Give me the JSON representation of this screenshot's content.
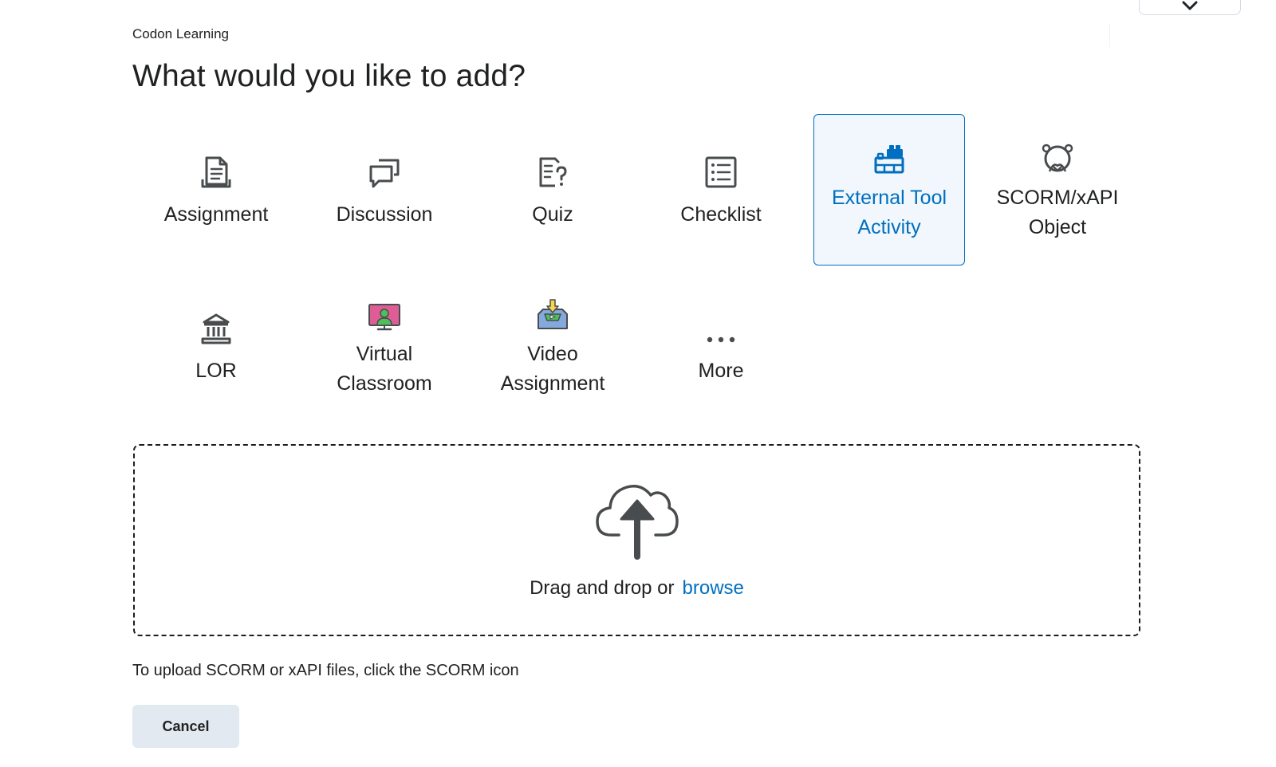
{
  "org": {
    "name": "Codon Learning"
  },
  "header": {
    "title": "What would you like to add?"
  },
  "tiles": [
    {
      "label": "Assignment",
      "icon": "assignment-icon"
    },
    {
      "label": "Discussion",
      "icon": "discussion-icon"
    },
    {
      "label": "Quiz",
      "icon": "quiz-icon"
    },
    {
      "label": "Checklist",
      "icon": "checklist-icon"
    },
    {
      "label": "External Tool\nActivity",
      "icon": "lego-brick-icon",
      "selected": true
    },
    {
      "label": "SCORM/xAPI\nObject",
      "icon": "scorm-icon"
    },
    {
      "label": "LOR",
      "icon": "library-icon"
    },
    {
      "label": "Virtual\nClassroom",
      "icon": "virtual-classroom-icon"
    },
    {
      "label": "Video\nAssignment",
      "icon": "video-assignment-icon"
    },
    {
      "label": "More",
      "icon": "ellipsis-icon"
    }
  ],
  "dropzone": {
    "text": "Drag and drop or",
    "browse_label": "browse",
    "icon": "upload-cloud-icon"
  },
  "hint": "To upload SCORM or xAPI files, click the SCORM icon",
  "actions": {
    "cancel_label": "Cancel"
  },
  "colors": {
    "accent": "#006fbf",
    "selected_bg": "#f1f7fd",
    "button_bg": "#e3e9f1",
    "text": "#202122"
  }
}
